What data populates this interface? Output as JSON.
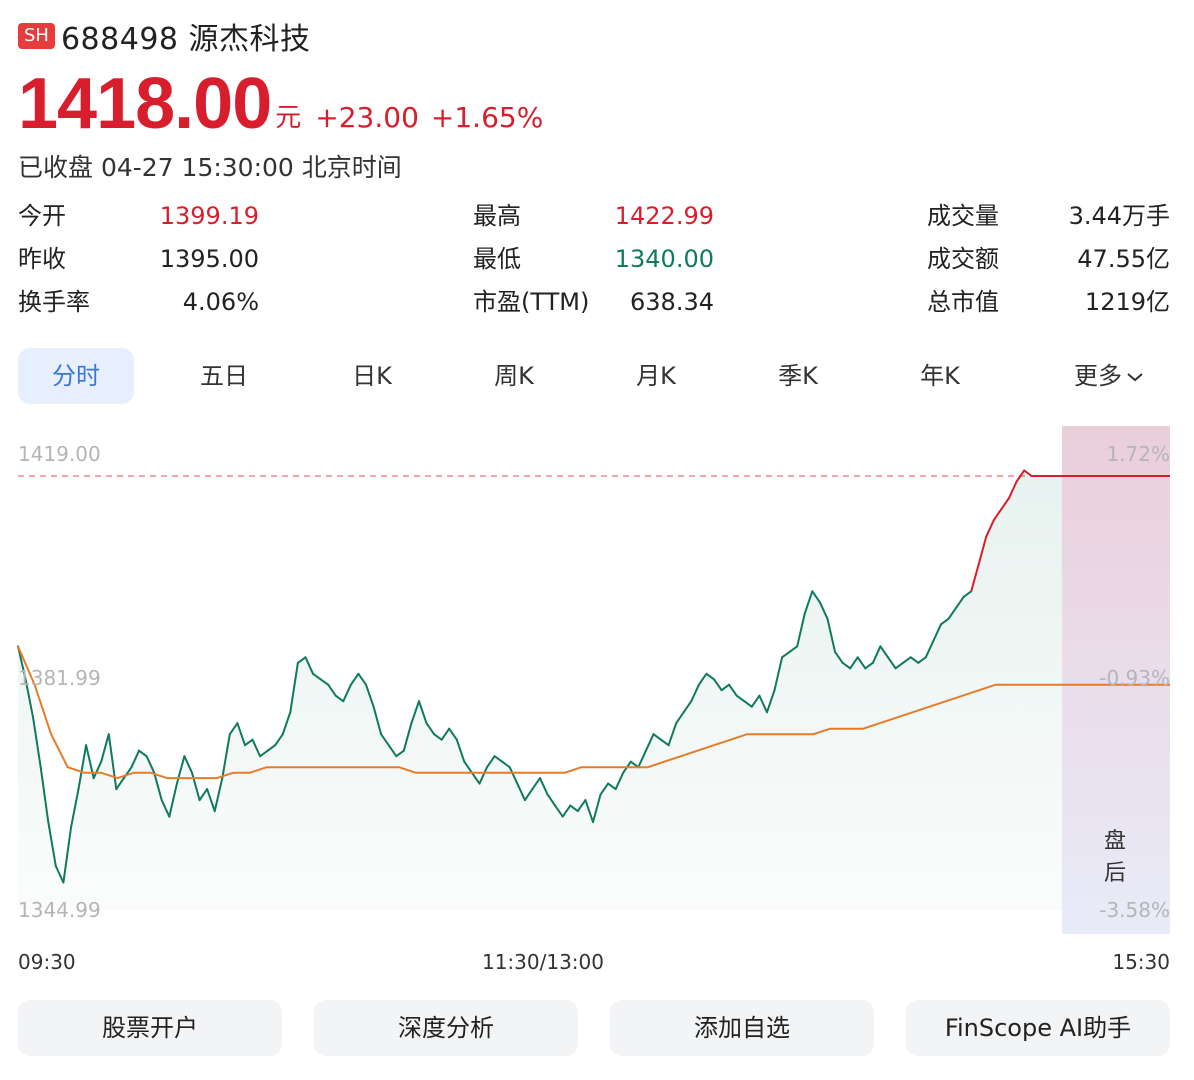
{
  "header": {
    "exchange": "SH",
    "title": "688498 源杰科技"
  },
  "quote": {
    "price": "1418.00",
    "unit": "元",
    "change": "+23.00",
    "change_pct": "+1.65%",
    "status": "已收盘 04-27 15:30:00 北京时间"
  },
  "stats": [
    [
      {
        "label": "今开",
        "value": "1399.19",
        "tone": "up"
      },
      {
        "label": "最高",
        "value": "1422.99",
        "tone": "up"
      },
      {
        "label": "成交量",
        "value": "3.44万手",
        "tone": "neutral"
      }
    ],
    [
      {
        "label": "昨收",
        "value": "1395.00",
        "tone": "neutral"
      },
      {
        "label": "最低",
        "value": "1340.00",
        "tone": "down"
      },
      {
        "label": "成交额",
        "value": "47.55亿",
        "tone": "neutral"
      }
    ],
    [
      {
        "label": "换手率",
        "value": "4.06%",
        "tone": "neutral"
      },
      {
        "label": "市盈(TTM)",
        "value": "638.34",
        "tone": "neutral"
      },
      {
        "label": "总市值",
        "value": "1219亿",
        "tone": "neutral"
      }
    ]
  ],
  "tabs": [
    "分时",
    "五日",
    "日K",
    "周K",
    "月K",
    "季K",
    "年K",
    "更多"
  ],
  "chart_data": {
    "type": "line",
    "y_ticks_left": [
      "1419.00",
      "1381.99",
      "1344.99"
    ],
    "y_ticks_right": [
      "1.72%",
      "-0.93%",
      "-3.58%"
    ],
    "x_ticks": [
      "09:30",
      "11:30/13:00",
      "15:30"
    ],
    "ylim": [
      1344.99,
      1419.0
    ],
    "after_hours_label": [
      "盘",
      "后"
    ],
    "series": [
      {
        "values": [
          1388,
          1382,
          1375,
          1366,
          1356,
          1348,
          1345,
          1355,
          1362,
          1370,
          1364,
          1367,
          1372,
          1362,
          1364,
          1366,
          1369,
          1368,
          1365,
          1360,
          1357,
          1363,
          1368,
          1365,
          1360,
          1362,
          1358,
          1364,
          1372,
          1374,
          1370,
          1371,
          1368,
          1369,
          1370,
          1372,
          1376,
          1385,
          1386,
          1383,
          1382,
          1381,
          1379,
          1378,
          1381,
          1383,
          1381,
          1377,
          1372,
          1370,
          1368,
          1369,
          1374,
          1378,
          1374,
          1372,
          1371,
          1373,
          1371,
          1367,
          1365,
          1363,
          1366,
          1368,
          1367,
          1366,
          1363,
          1360,
          1362,
          1364,
          1361,
          1359,
          1357,
          1359,
          1358,
          1360,
          1356,
          1361,
          1363,
          1362,
          1365,
          1367,
          1366,
          1369,
          1372,
          1371,
          1370,
          1374,
          1376,
          1378,
          1381,
          1383,
          1382,
          1380,
          1381,
          1379,
          1378,
          1377,
          1379,
          1376,
          1380,
          1386,
          1387,
          1388,
          1394,
          1398,
          1396,
          1393,
          1387,
          1385,
          1384,
          1386,
          1384,
          1385,
          1388,
          1386,
          1384,
          1385,
          1386,
          1385,
          1386,
          1389,
          1392,
          1393,
          1395,
          1397,
          1398,
          1403,
          1408,
          1411,
          1413,
          1415,
          1418,
          1420,
          1419,
          1419,
          1419,
          1419,
          1419
        ],
        "color": "#0f7a5e",
        "up_color": "#d81e2c"
      },
      {
        "values": [
          1388,
          1381,
          1372,
          1366,
          1365,
          1365,
          1364,
          1365,
          1365,
          1364,
          1364,
          1364,
          1364,
          1365,
          1365,
          1366,
          1366,
          1366,
          1366,
          1366,
          1366,
          1366,
          1366,
          1366,
          1365,
          1365,
          1365,
          1365,
          1365,
          1365,
          1365,
          1365,
          1365,
          1365,
          1366,
          1366,
          1366,
          1366,
          1366,
          1367,
          1368,
          1369,
          1370,
          1371,
          1372,
          1372,
          1372,
          1372,
          1372,
          1373,
          1373,
          1373,
          1374,
          1375,
          1376,
          1377,
          1378,
          1379,
          1380,
          1381,
          1381,
          1381,
          1381,
          1381
        ],
        "color": "#e57c2a"
      }
    ],
    "reference_line": 1419.0
  },
  "footer": [
    "股票开户",
    "深度分析",
    "添加自选",
    "FinScope AI助手"
  ]
}
